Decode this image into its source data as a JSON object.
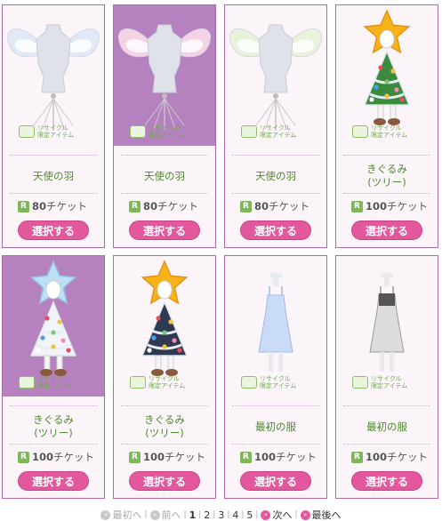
{
  "stamp_text": "リサイクル\n限定アイテム",
  "items": [
    {
      "name": "天使の羽",
      "price": "80",
      "unit": "チケット",
      "currency_badge": "R",
      "button": "選択する",
      "selected": false,
      "icon": "angel-wings-icon"
    },
    {
      "name": "天使の羽",
      "price": "80",
      "unit": "チケット",
      "currency_badge": "R",
      "button": "選択する",
      "selected": true,
      "icon": "angel-wings-icon"
    },
    {
      "name": "天使の羽",
      "price": "80",
      "unit": "チケット",
      "currency_badge": "R",
      "button": "選択する",
      "selected": false,
      "icon": "angel-wings-icon"
    },
    {
      "name": "きぐるみ\n(ツリー)",
      "price": "100",
      "unit": "チケット",
      "currency_badge": "R",
      "button": "選択する",
      "selected": false,
      "icon": "christmas-tree-costume-icon"
    },
    {
      "name": "きぐるみ\n(ツリー)",
      "price": "100",
      "unit": "チケット",
      "currency_badge": "R",
      "button": "選択する",
      "selected": true,
      "icon": "christmas-tree-costume-icon"
    },
    {
      "name": "きぐるみ\n(ツリー)",
      "price": "100",
      "unit": "チケット",
      "currency_badge": "R",
      "button": "選択する",
      "selected": false,
      "icon": "christmas-tree-costume-icon"
    },
    {
      "name": "最初の服",
      "price": "100",
      "unit": "チケット",
      "currency_badge": "R",
      "button": "選択する",
      "selected": false,
      "icon": "dress-icon"
    },
    {
      "name": "最初の服",
      "price": "100",
      "unit": "チケット",
      "currency_badge": "R",
      "button": "選択する",
      "selected": false,
      "icon": "dress-icon"
    }
  ],
  "pager": {
    "first": "最初へ",
    "prev": "前へ",
    "pages": [
      "1",
      "2",
      "3",
      "4",
      "5"
    ],
    "current": "1",
    "next": "次へ",
    "last": "最後へ"
  }
}
